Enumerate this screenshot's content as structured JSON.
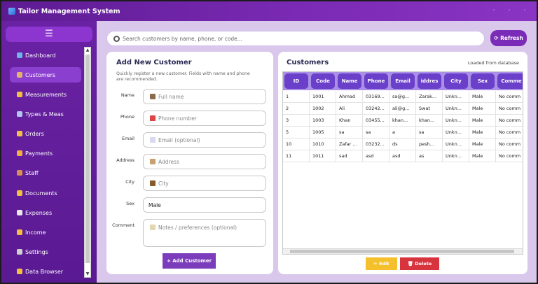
{
  "window": {
    "title": "Tailor Management System",
    "controls": [
      "minimize",
      "maximize",
      "close"
    ]
  },
  "sidebar": {
    "menu_icon": "hamburger-icon",
    "items": [
      {
        "label": "Dashboard",
        "icon": "chart-icon",
        "color": "#6fb6e8",
        "active": false
      },
      {
        "label": "Customers",
        "icon": "user-icon",
        "color": "#e0b46a",
        "active": true
      },
      {
        "label": "Measurements",
        "icon": "ruler-icon",
        "color": "#f0c040",
        "active": false
      },
      {
        "label": "Types & Meas",
        "icon": "spool-icon",
        "color": "#b0c8f0",
        "active": false
      },
      {
        "label": "Orders",
        "icon": "box-icon",
        "color": "#f2c04a",
        "active": false
      },
      {
        "label": "Payments",
        "icon": "card-icon",
        "color": "#f2b040",
        "active": false
      },
      {
        "label": "Staff",
        "icon": "people-icon",
        "color": "#d89050",
        "active": false
      },
      {
        "label": "Documents",
        "icon": "folder-icon",
        "color": "#f2c040",
        "active": false
      },
      {
        "label": "Expenses",
        "icon": "money-icon",
        "color": "#e8e8e8",
        "active": false
      },
      {
        "label": "Income",
        "icon": "coin-icon",
        "color": "#f2c040",
        "active": false
      },
      {
        "label": "Settings",
        "icon": "gear-icon",
        "color": "#d0d0d0",
        "active": false
      },
      {
        "label": "Data Browser",
        "icon": "folder-icon",
        "color": "#f2c040",
        "active": false
      }
    ]
  },
  "search": {
    "placeholder": "Search customers by name, phone, or code..."
  },
  "toolbar": {
    "refresh_label": "⟳ Refresh"
  },
  "form": {
    "title": "Add New Customer",
    "description": "Quickly register a new customer. Fields with name and phone are recommended.",
    "fields": {
      "name": {
        "label": "Name",
        "placeholder": "Full name",
        "icon": "person-icon"
      },
      "phone": {
        "label": "Phone",
        "placeholder": "Phone number",
        "icon": "phone-icon"
      },
      "email": {
        "label": "Email",
        "placeholder": "Email (optional)",
        "icon": "email-icon"
      },
      "address": {
        "label": "Address",
        "placeholder": "Address",
        "icon": "house-icon"
      },
      "city": {
        "label": "City",
        "placeholder": "City",
        "icon": "building-icon"
      },
      "sex": {
        "label": "Sex",
        "value": "Male"
      },
      "comment": {
        "label": "Comment",
        "placeholder": "Notes / preferences (optional)",
        "icon": "note-icon"
      }
    },
    "add_label": "+ Add Customer"
  },
  "customers": {
    "title": "Customers",
    "status": "Loaded from database",
    "columns": [
      "ID",
      "Code",
      "Name",
      "Phone",
      "Email",
      "iddres",
      "City",
      "Sex",
      "Comme"
    ],
    "rows": [
      [
        "1",
        "1001",
        "Ahmad",
        "03169...",
        "sa@g...",
        "Zarak...",
        "Unkn...",
        "Male",
        "No comm"
      ],
      [
        "2",
        "1002",
        "Ali",
        "03242...",
        "ali@g...",
        "Swat",
        "Unkn...",
        "Male",
        "No comm"
      ],
      [
        "3",
        "1003",
        "Khan",
        "03455...",
        "khan...",
        "khan...",
        "Unkn...",
        "Male",
        "No comm"
      ],
      [
        "5",
        "1005",
        "sa",
        "sa",
        "a",
        "sa",
        "Unkn...",
        "Male",
        "No comm"
      ],
      [
        "10",
        "1010",
        "Zafar ...",
        "03232...",
        "ds",
        "pesh...",
        "Unkn...",
        "Male",
        "No comm"
      ],
      [
        "11",
        "1011",
        "sad",
        "asd",
        "asd",
        "as",
        "Unkn...",
        "Male",
        "No comm"
      ]
    ],
    "edit_label": "✏ Edit",
    "delete_label": "🗑 Delete"
  }
}
